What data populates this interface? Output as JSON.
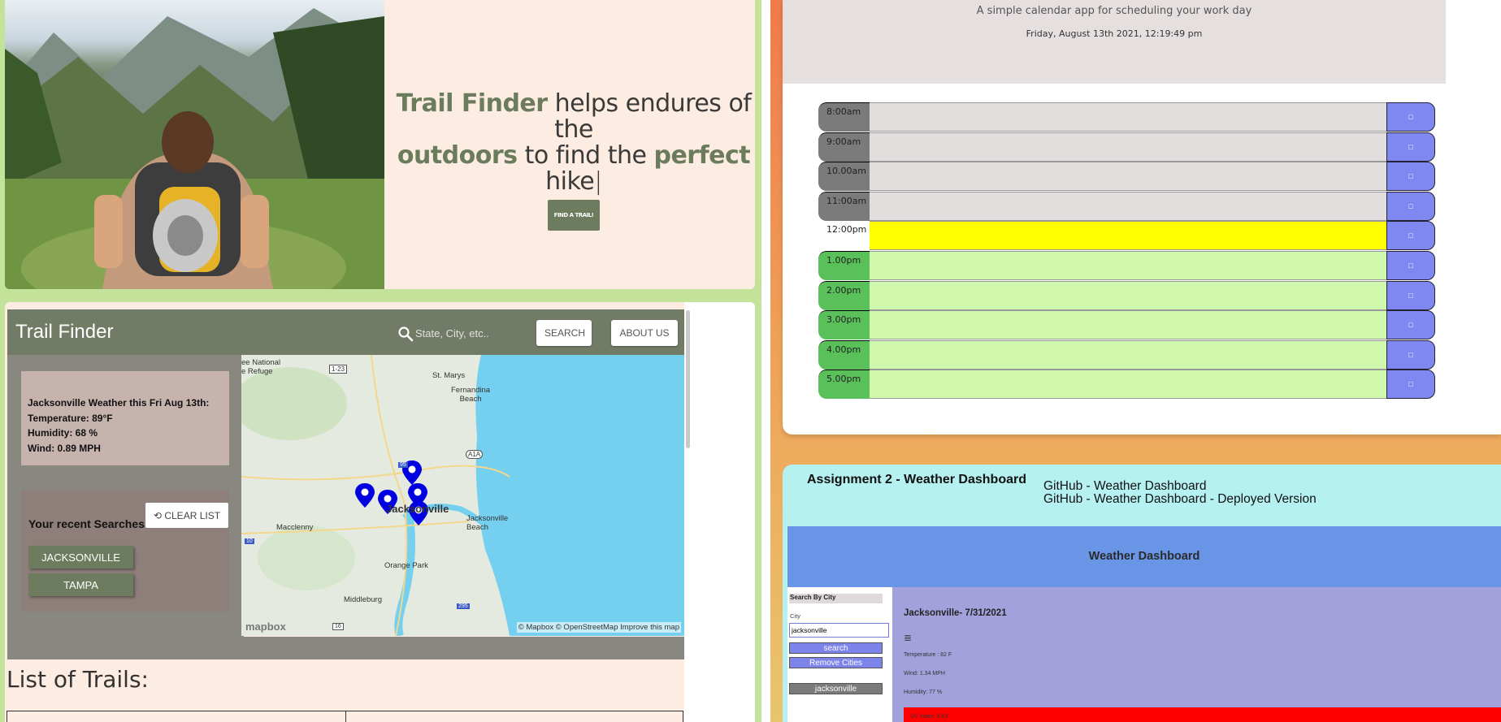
{
  "hero": {
    "brand": "Trail Finder",
    "text_1": " helps endures of the",
    "highlight_2": "outdoors",
    "text_2": " to find the ",
    "highlight_3": "perfect",
    "text_3": " hike",
    "cta": "FIND A TRAIL!"
  },
  "trail_finder": {
    "nav": {
      "brand": "Trail Finder",
      "search_placeholder": "State, City, etc..",
      "search_button": "SEARCH",
      "about_button": "ABOUT US"
    },
    "weather": {
      "title": "Jacksonville Weather this Fri Aug 13th:",
      "temperature": "Temperature: 89°F",
      "humidity": "Humidity: 68 %",
      "wind": "Wind: 0.89 MPH"
    },
    "recent": {
      "title": "Your recent Searches",
      "clear_button": "CLEAR LIST",
      "cities": [
        "JACKSONVILLE",
        "TAMPA"
      ]
    },
    "map": {
      "labels": [
        "ee National\ne Refuge",
        "St. Marys",
        "Fernandina\nBeach",
        "Jacksonville",
        "Jacksonville\nBeach",
        "Macclenny",
        "Orange Park",
        "Middleburg"
      ],
      "road_shields": [
        "1-23",
        "A1A",
        "95",
        "10",
        "295",
        "16"
      ],
      "attribution": "© Mapbox © OpenStreetMap Improve this map",
      "logo": "mapbox"
    },
    "list_title": "List of Trails:"
  },
  "scheduler": {
    "subtitle": "A simple calendar app for scheduling your work day",
    "date": "Friday, August 13th 2021, 12:19:49 pm",
    "save_icon": "□",
    "hours": [
      {
        "label": "8:00am",
        "state": "past"
      },
      {
        "label": "9:00am",
        "state": "past"
      },
      {
        "label": "10.00am",
        "state": "past"
      },
      {
        "label": "11:00am",
        "state": "past"
      },
      {
        "label": "12:00pm",
        "state": "present"
      },
      {
        "label": "1.00pm",
        "state": "future"
      },
      {
        "label": "2.00pm",
        "state": "future"
      },
      {
        "label": "3.00pm",
        "state": "future"
      },
      {
        "label": "4.00pm",
        "state": "future"
      },
      {
        "label": "5.00pm",
        "state": "future"
      }
    ]
  },
  "weather_assignment": {
    "title": "Assignment 2 - Weather Dashboard",
    "link_1": "GitHub - Weather Dashboard",
    "link_2": "GitHub - Weather Dashboard - Deployed Version",
    "dashboard": {
      "header": "Weather Dashboard",
      "search_label": "Search By City",
      "city_label": "City",
      "city_value": "jacksonville",
      "search_button": "search",
      "remove_button": "Remove Cities",
      "history": [
        "jacksonville"
      ],
      "result_title": "Jacksonville- 7/31/2021",
      "icon": "mist-icon",
      "temperature": "Temperature : 82 F",
      "wind": "Wind: 1.34 MPH",
      "humidity": "Humidity: 77 %",
      "uv": "UV Index: 0.63"
    }
  }
}
